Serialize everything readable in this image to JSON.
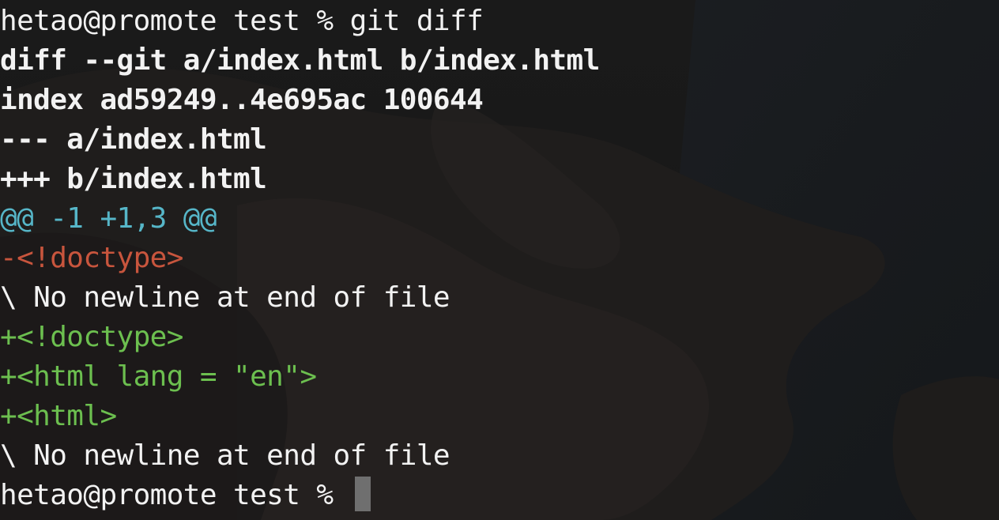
{
  "terminal": {
    "prompt": "hetao@promote test % ",
    "command": "git diff",
    "diff_header": [
      "diff --git a/index.html b/index.html",
      "index ad59249..4e695ac 100644",
      "--- a/index.html",
      "+++ b/index.html"
    ],
    "hunk_header": "@@ -1 +1,3 @@",
    "removed_lines": [
      "-<!doctype>"
    ],
    "no_newline_1": "\\ No newline at end of file",
    "added_lines": [
      "+<!doctype>",
      "+<html lang = \"en\">",
      "+<html>"
    ],
    "no_newline_2": "\\ No newline at end of file",
    "final_prompt": "hetao@promote test % "
  },
  "colors": {
    "text": "#f2f2f2",
    "hunk": "#56b6c8",
    "removed": "#c8553d",
    "added": "#6cbf4f",
    "cursor": "#6f6f6f"
  }
}
